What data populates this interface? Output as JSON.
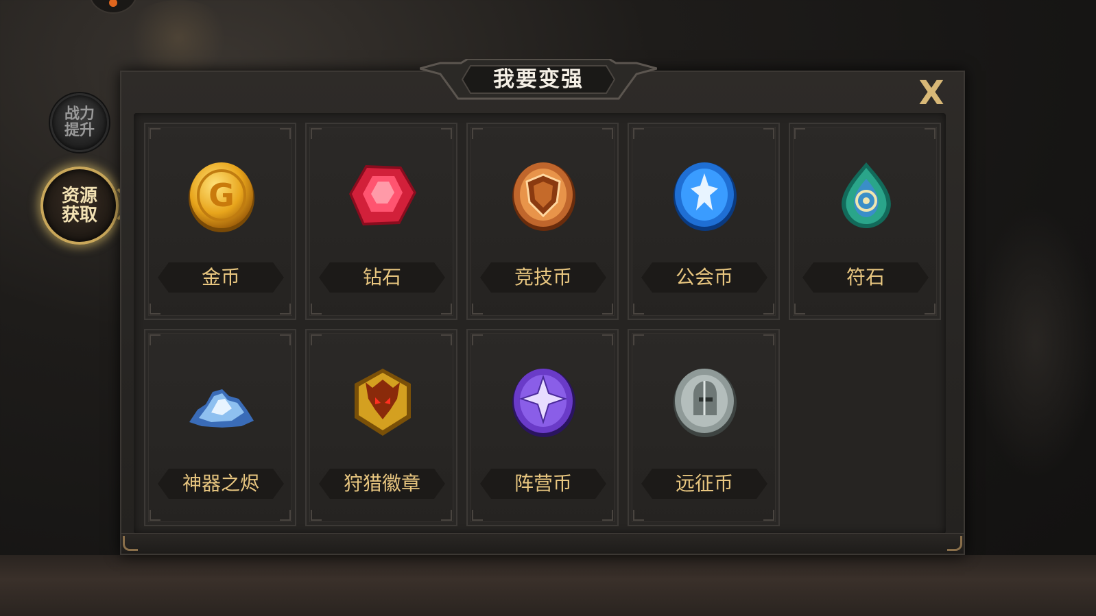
{
  "title": "我要变强",
  "close_label": "X",
  "side_tabs": [
    {
      "label": "战力提升",
      "line1": "战力",
      "line2": "提升",
      "active": false
    },
    {
      "label": "资源获取",
      "line1": "资源",
      "line2": "获取",
      "active": true
    }
  ],
  "resources": [
    {
      "label": "金币",
      "icon": "gold-coin-icon",
      "color": "#e8a51c"
    },
    {
      "label": "钻石",
      "icon": "diamond-icon",
      "color": "#d2203a"
    },
    {
      "label": "竞技币",
      "icon": "arena-coin-icon",
      "color": "#c0662c"
    },
    {
      "label": "公会币",
      "icon": "guild-coin-icon",
      "color": "#1f6fd4"
    },
    {
      "label": "符石",
      "icon": "rune-stone-icon",
      "color": "#2aa58a"
    },
    {
      "label": "神器之烬",
      "icon": "artifact-ash-icon",
      "color": "#8ec0f0"
    },
    {
      "label": "狩猎徽章",
      "icon": "hunting-badge-icon",
      "color": "#d4a020"
    },
    {
      "label": "阵营币",
      "icon": "faction-coin-icon",
      "color": "#6a3bc8"
    },
    {
      "label": "远征币",
      "icon": "expedition-coin-icon",
      "color": "#8f9a98"
    }
  ],
  "colors": {
    "accent_gold": "#d8b877",
    "label_gold": "#e9c780",
    "panel_bg": "#2e2b28"
  }
}
